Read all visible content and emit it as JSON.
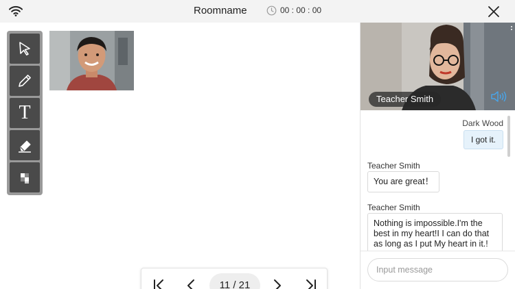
{
  "header": {
    "room_name": "Roomname",
    "timer": "00 : 00 : 00",
    "icons": [
      "wifi-icon",
      "clock-icon",
      "close-icon"
    ]
  },
  "toolbar": {
    "tools": [
      {
        "name": "select",
        "icon": "pointer-icon"
      },
      {
        "name": "pen",
        "icon": "pencil-icon"
      },
      {
        "name": "text",
        "label": "T",
        "icon": "text-icon"
      },
      {
        "name": "eraser",
        "icon": "eraser-icon"
      },
      {
        "name": "mosaic",
        "icon": "mosaic-icon"
      }
    ],
    "background": "#9a9a9a",
    "tool_color": "#4a4a4a"
  },
  "pager": {
    "current_label": "11 / 21",
    "icons": [
      "first-page-icon",
      "prev-page-icon",
      "next-page-icon",
      "last-page-icon"
    ]
  },
  "teacher": {
    "name": "Teacher Smith"
  },
  "chat": {
    "messages": [
      {
        "sender": "Dark Wood",
        "text": "I got it.",
        "side": "right"
      },
      {
        "sender": "Teacher Smith",
        "text": "You are great！",
        "side": "left"
      },
      {
        "sender": "Teacher Smith",
        "text": "Nothing is impossible.I'm the best in my heart!I I can do that as long as I put My heart in it.!",
        "side": "left"
      }
    ]
  },
  "input": {
    "placeholder": "Input message"
  },
  "colors": {
    "topbar": "#f3f3f3",
    "own_bubble": "#e6f2fb",
    "speaker_accent": "#4aa3e6"
  }
}
